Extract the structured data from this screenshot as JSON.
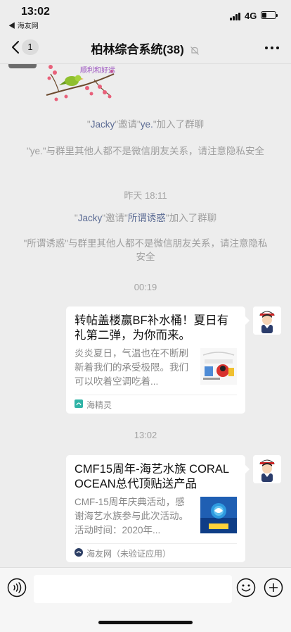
{
  "status_bar": {
    "time": "13:02",
    "back_app": "◀ 海友网",
    "network": "4G",
    "battery_level": 0.35
  },
  "nav": {
    "unread_count": "1",
    "title": "柏林综合系统(38)",
    "icons": [
      "back-chevron-icon",
      "mute-bell-icon",
      "more-dots-icon"
    ]
  },
  "sticker": {
    "text": "顺利和好运"
  },
  "messages": {
    "sys1": {
      "q1": "\"",
      "nick1": "Jacky",
      "mid": "\"邀请\"",
      "nick2": "ye.",
      "end": "\"加入了群聊"
    },
    "sys2": {
      "text": "\"ye.\"与群里其他人都不是微信朋友关系，请注意隐私安全"
    },
    "time1": "昨天 18:11",
    "sys3": {
      "q1": "\"",
      "nick1": "Jacky",
      "mid": "\"邀请\"",
      "nick2": "所谓诱惑",
      "end": "\"加入了群聊"
    },
    "sys4": {
      "text": "\"所谓诱惑\"与群里其他人都不是微信朋友关系，请注意隐私安全"
    },
    "time2": "00:19",
    "card1": {
      "title": "转帖盖楼赢BF补水桶！夏日有礼第二弹，为你而来。",
      "desc": "炎炎夏日，气温也在不断刷新着我们的承受极限。我们可以吹着空调吃着...",
      "source": "海精灵"
    },
    "time3": "13:02",
    "card2": {
      "title": "CMF15周年-海艺水族 CORAL OCEAN总代顶贴送产品",
      "desc": "CMF-15周年庆典活动，感谢海艺水族参与此次活动。活动时间：2020年...",
      "source": "海友网（未验证应用）"
    }
  },
  "input_bar": {
    "placeholder": "",
    "icons": [
      "voice-icon",
      "emoji-icon",
      "plus-icon"
    ]
  },
  "colors": {
    "background": "#ededed",
    "nickname": "#5b6b94",
    "system_text": "#9e9e9e",
    "bubble": "#ffffff"
  }
}
